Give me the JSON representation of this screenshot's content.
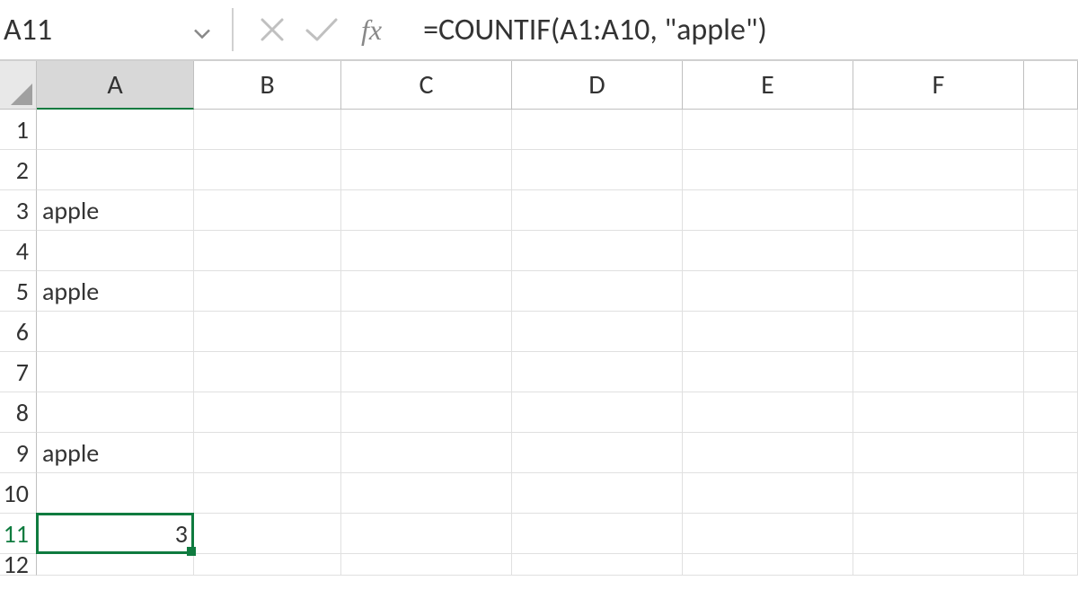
{
  "formula_bar": {
    "name_box": "A11",
    "fx_label": "fx",
    "formula": "=COUNTIF(A1:A10, \"apple\")"
  },
  "columns": [
    "A",
    "B",
    "C",
    "D",
    "E",
    "F"
  ],
  "rows": [
    "1",
    "2",
    "3",
    "4",
    "5",
    "6",
    "7",
    "8",
    "9",
    "10",
    "11",
    "12"
  ],
  "selected": {
    "col": "A",
    "row": "11"
  },
  "cells": {
    "A3": "apple",
    "A5": "apple",
    "A9": "apple",
    "A11": "3"
  },
  "colors": {
    "selection_green": "#0f7b3f",
    "grid_line": "#e0e0e0",
    "header_border": "#c0c0c0"
  }
}
